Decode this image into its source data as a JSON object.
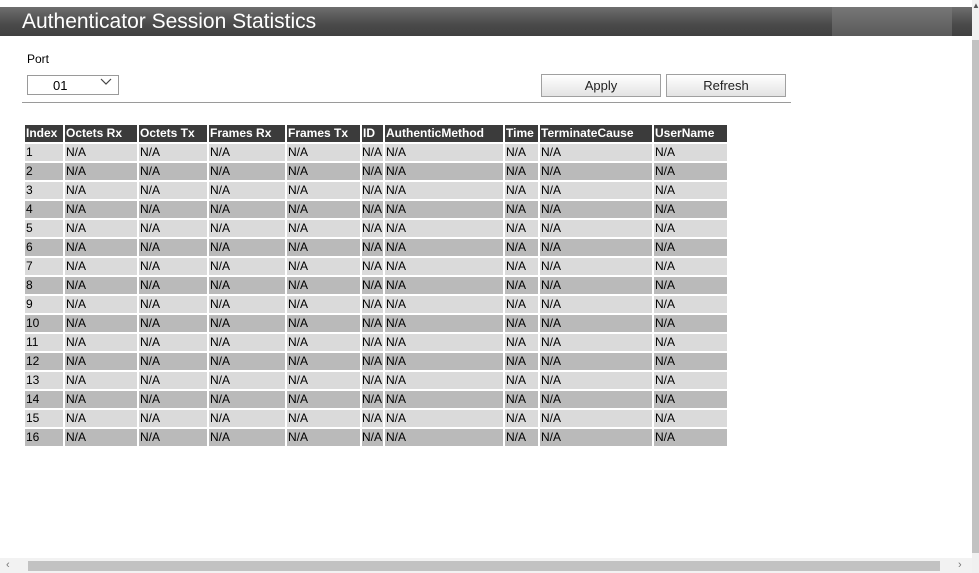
{
  "header": {
    "title": "Authenticator Session Statistics"
  },
  "form": {
    "port_label": "Port",
    "port_value": "01",
    "apply_label": "Apply",
    "refresh_label": "Refresh"
  },
  "icons": {
    "chevron": "chevron-down-icon",
    "scroll_left": "arrow-left-icon",
    "scroll_right": "arrow-right-icon",
    "scroll_up": "arrow-up-icon"
  },
  "colors": {
    "title_bar": "#4a4a4a",
    "header_row": "#3b3b3b",
    "row_light": "#dadada",
    "row_dark": "#bababa"
  },
  "table": {
    "columns": [
      "Index",
      "Octets Rx",
      "Octets Tx",
      "Frames Rx",
      "Frames Tx",
      "ID",
      "AuthenticMethod",
      "Time",
      "TerminateCause",
      "UserName"
    ],
    "rows": [
      [
        "1",
        "N/A",
        "N/A",
        "N/A",
        "N/A",
        "N/A",
        "N/A",
        "N/A",
        "N/A",
        "N/A"
      ],
      [
        "2",
        "N/A",
        "N/A",
        "N/A",
        "N/A",
        "N/A",
        "N/A",
        "N/A",
        "N/A",
        "N/A"
      ],
      [
        "3",
        "N/A",
        "N/A",
        "N/A",
        "N/A",
        "N/A",
        "N/A",
        "N/A",
        "N/A",
        "N/A"
      ],
      [
        "4",
        "N/A",
        "N/A",
        "N/A",
        "N/A",
        "N/A",
        "N/A",
        "N/A",
        "N/A",
        "N/A"
      ],
      [
        "5",
        "N/A",
        "N/A",
        "N/A",
        "N/A",
        "N/A",
        "N/A",
        "N/A",
        "N/A",
        "N/A"
      ],
      [
        "6",
        "N/A",
        "N/A",
        "N/A",
        "N/A",
        "N/A",
        "N/A",
        "N/A",
        "N/A",
        "N/A"
      ],
      [
        "7",
        "N/A",
        "N/A",
        "N/A",
        "N/A",
        "N/A",
        "N/A",
        "N/A",
        "N/A",
        "N/A"
      ],
      [
        "8",
        "N/A",
        "N/A",
        "N/A",
        "N/A",
        "N/A",
        "N/A",
        "N/A",
        "N/A",
        "N/A"
      ],
      [
        "9",
        "N/A",
        "N/A",
        "N/A",
        "N/A",
        "N/A",
        "N/A",
        "N/A",
        "N/A",
        "N/A"
      ],
      [
        "10",
        "N/A",
        "N/A",
        "N/A",
        "N/A",
        "N/A",
        "N/A",
        "N/A",
        "N/A",
        "N/A"
      ],
      [
        "11",
        "N/A",
        "N/A",
        "N/A",
        "N/A",
        "N/A",
        "N/A",
        "N/A",
        "N/A",
        "N/A"
      ],
      [
        "12",
        "N/A",
        "N/A",
        "N/A",
        "N/A",
        "N/A",
        "N/A",
        "N/A",
        "N/A",
        "N/A"
      ],
      [
        "13",
        "N/A",
        "N/A",
        "N/A",
        "N/A",
        "N/A",
        "N/A",
        "N/A",
        "N/A",
        "N/A"
      ],
      [
        "14",
        "N/A",
        "N/A",
        "N/A",
        "N/A",
        "N/A",
        "N/A",
        "N/A",
        "N/A",
        "N/A"
      ],
      [
        "15",
        "N/A",
        "N/A",
        "N/A",
        "N/A",
        "N/A",
        "N/A",
        "N/A",
        "N/A",
        "N/A"
      ],
      [
        "16",
        "N/A",
        "N/A",
        "N/A",
        "N/A",
        "N/A",
        "N/A",
        "N/A",
        "N/A",
        "N/A"
      ]
    ]
  }
}
